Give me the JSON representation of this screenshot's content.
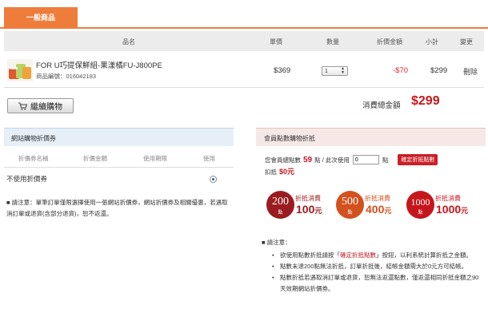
{
  "tabs": {
    "general": "一般商品"
  },
  "cart_header": {
    "name": "品名",
    "price": "單價",
    "qty": "數量",
    "discount": "折價金額",
    "subtotal": "小計",
    "change": "變更"
  },
  "product": {
    "name": "FOR U巧提保鮮組-果漾橘FU-J800PE",
    "code": "商品編號：016042183",
    "price": "$369",
    "qty": "1",
    "discount": "-$70",
    "subtotal": "$299",
    "delete": "刪除"
  },
  "continue_button": "繼續購物",
  "total": {
    "label": "消費總金額",
    "amount": "$299"
  },
  "coupon": {
    "title": "網站購物折價券",
    "cols": {
      "name": "折價券名稱",
      "amount": "折價金額",
      "period": "使用期限",
      "use": "使用"
    },
    "none_label": "不使用折價券",
    "note": "■ 請注意：單筆訂單僅限選擇使用一張網站折價券，網站折價券及相關優惠，若遇取消訂單或退貨(含部分退貨)，恕不返還。"
  },
  "points": {
    "title": "會員點數購物折抵",
    "total_prefix": "您會員總點數",
    "total_value": "59",
    "total_suffix": "點 / 此次使用",
    "input_value": "0",
    "input_suffix": "點",
    "confirm_button": "確定折抵點數",
    "deduct_label": "扣抵",
    "deduct_amount": "$0元",
    "badges": [
      {
        "points": "200",
        "unit": "點",
        "label": "折抵消費",
        "value": "100",
        "yuan": "元",
        "color": "#9b1c20"
      },
      {
        "points": "500",
        "unit": "點",
        "label": "折抵消費",
        "value": "400",
        "yuan": "元",
        "color": "#d2511d"
      },
      {
        "points": "1000",
        "unit": "點",
        "label": "折抵消費",
        "value": "1000",
        "yuan": "元",
        "color": "#c4161c"
      }
    ],
    "note_title": "■ 請注意：",
    "notes": {
      "n1_a": "欲使用點數折抵請按「",
      "n1_b": "確定折抵點數",
      "n1_c": "」按鈕，以利系統計算折抵之金額。",
      "n2": "點數未達200點無法折抵，訂單折抵後，結帳金額需大於0元方可結帳。",
      "n3": "點數折抵若遇取消訂單或退貨，恕無法返還點數，僅返還相同折抵金額之90天效期網站折價券。"
    }
  },
  "colors": {
    "accent": "#ee7d3c",
    "red": "#c4161c",
    "blue_header": "#e6eef7",
    "pink_header": "#f6e8e6"
  }
}
